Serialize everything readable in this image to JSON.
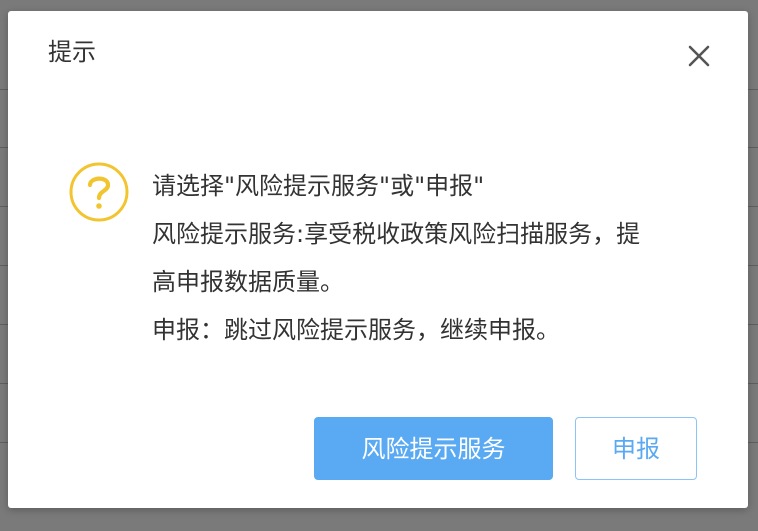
{
  "dialog": {
    "title": "提示",
    "close_icon": "close-icon",
    "question_icon": "question-icon",
    "message_lines": [
      "请选择\"风险提示服务\"或\"申报\"",
      "风险提示服务:享受税收政策风险扫描服务，提高申报数据质量。",
      "申报：跳过风险提示服务，继续申报。"
    ],
    "primary_button": "风险提示服务",
    "secondary_button": "申报"
  },
  "colors": {
    "accent": "#5aaaf3",
    "icon": "#f2c530",
    "text": "#333333"
  }
}
